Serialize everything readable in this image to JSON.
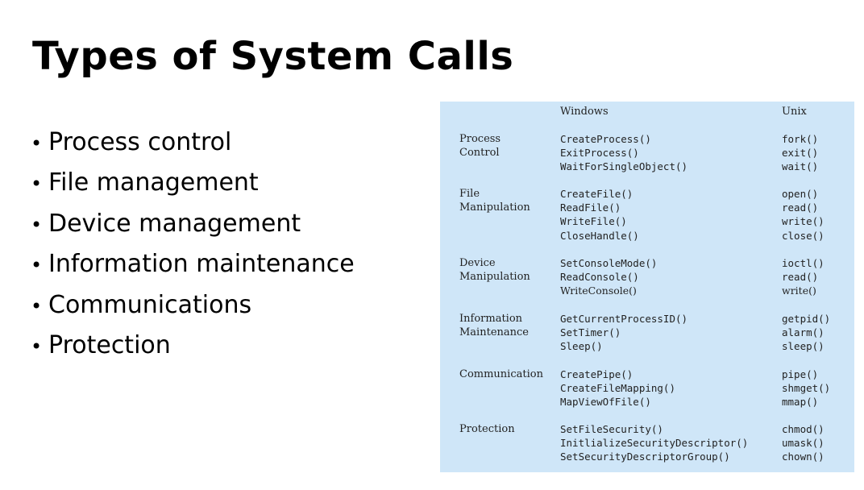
{
  "slide": {
    "title": "Types of System Calls",
    "bullets": [
      "Process control",
      "File management",
      "Device management",
      "Information maintenance",
      "Communications",
      "Protection"
    ]
  },
  "table": {
    "headers": {
      "windows": "Windows",
      "unix": "Unix"
    },
    "groups": [
      {
        "category": [
          "Process",
          "Control"
        ],
        "rows": [
          {
            "windows": "CreateProcess()",
            "unix": "fork()"
          },
          {
            "windows": "ExitProcess()",
            "unix": "exit()"
          },
          {
            "windows": "WaitForSingleObject()",
            "unix": "wait()"
          }
        ]
      },
      {
        "category": [
          "File",
          "Manipulation"
        ],
        "rows": [
          {
            "windows": "CreateFile()",
            "unix": "open()"
          },
          {
            "windows": "ReadFile()",
            "unix": "read()"
          },
          {
            "windows": "WriteFile()",
            "unix": "write()"
          },
          {
            "windows": "CloseHandle()",
            "unix": "close()"
          }
        ]
      },
      {
        "category": [
          "Device",
          "Manipulation"
        ],
        "rows": [
          {
            "windows": "SetConsoleMode()",
            "unix": "ioctl()"
          },
          {
            "windows": "ReadConsole()",
            "unix": "read()"
          },
          {
            "windows": "WriteConsole()",
            "unix": "write()"
          }
        ]
      },
      {
        "category": [
          "Information",
          "Maintenance"
        ],
        "rows": [
          {
            "windows": "GetCurrentProcessID()",
            "unix": "getpid()"
          },
          {
            "windows": "SetTimer()",
            "unix": "alarm()"
          },
          {
            "windows": "Sleep()",
            "unix": "sleep()"
          }
        ]
      },
      {
        "category": [
          "Communication"
        ],
        "rows": [
          {
            "windows": "CreatePipe()",
            "unix": "pipe()"
          },
          {
            "windows": "CreateFileMapping()",
            "unix": "shmget()"
          },
          {
            "windows": "MapViewOfFile()",
            "unix": "mmap()"
          }
        ]
      },
      {
        "category": [
          "Protection"
        ],
        "rows": [
          {
            "windows": "SetFileSecurity()",
            "unix": "chmod()"
          },
          {
            "windows": "InitlializeSecurityDescriptor()",
            "unix": "umask()"
          },
          {
            "windows": "SetSecurityDescriptorGroup()",
            "unix": "chown()"
          }
        ]
      }
    ]
  }
}
